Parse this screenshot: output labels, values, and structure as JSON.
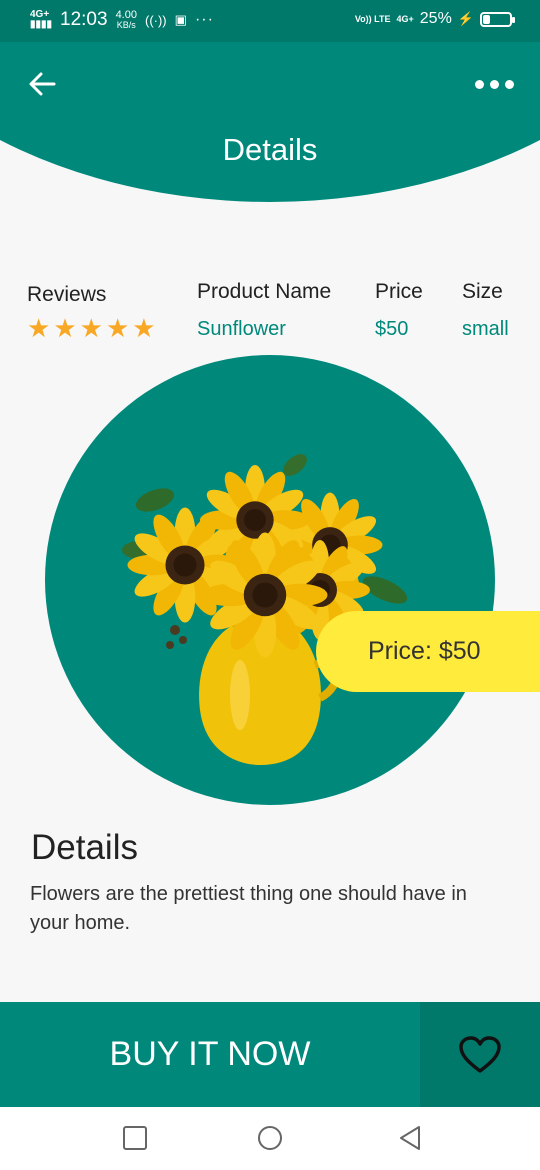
{
  "status_bar": {
    "network": "4G+",
    "time": "12:03",
    "speed_value": "4.00",
    "speed_unit": "KB/s",
    "volte": "Vo)) LTE",
    "network_right": "4G+",
    "battery": "25%"
  },
  "header": {
    "title": "Details"
  },
  "product": {
    "reviews_label": "Reviews",
    "rating": 5,
    "name_label": "Product Name",
    "name": "Sunflower",
    "price_label": "Price",
    "price": "$50",
    "size_label": "Size",
    "size": "small"
  },
  "price_tag": "Price: $50",
  "details": {
    "heading": "Details",
    "text": "Flowers are the prettiest thing one should have in your home."
  },
  "actions": {
    "buy_label": "BUY IT NOW"
  },
  "colors": {
    "primary": "#00897b",
    "primary_dark": "#00796b",
    "accent": "#ffeb3b",
    "star": "#f9a825"
  }
}
